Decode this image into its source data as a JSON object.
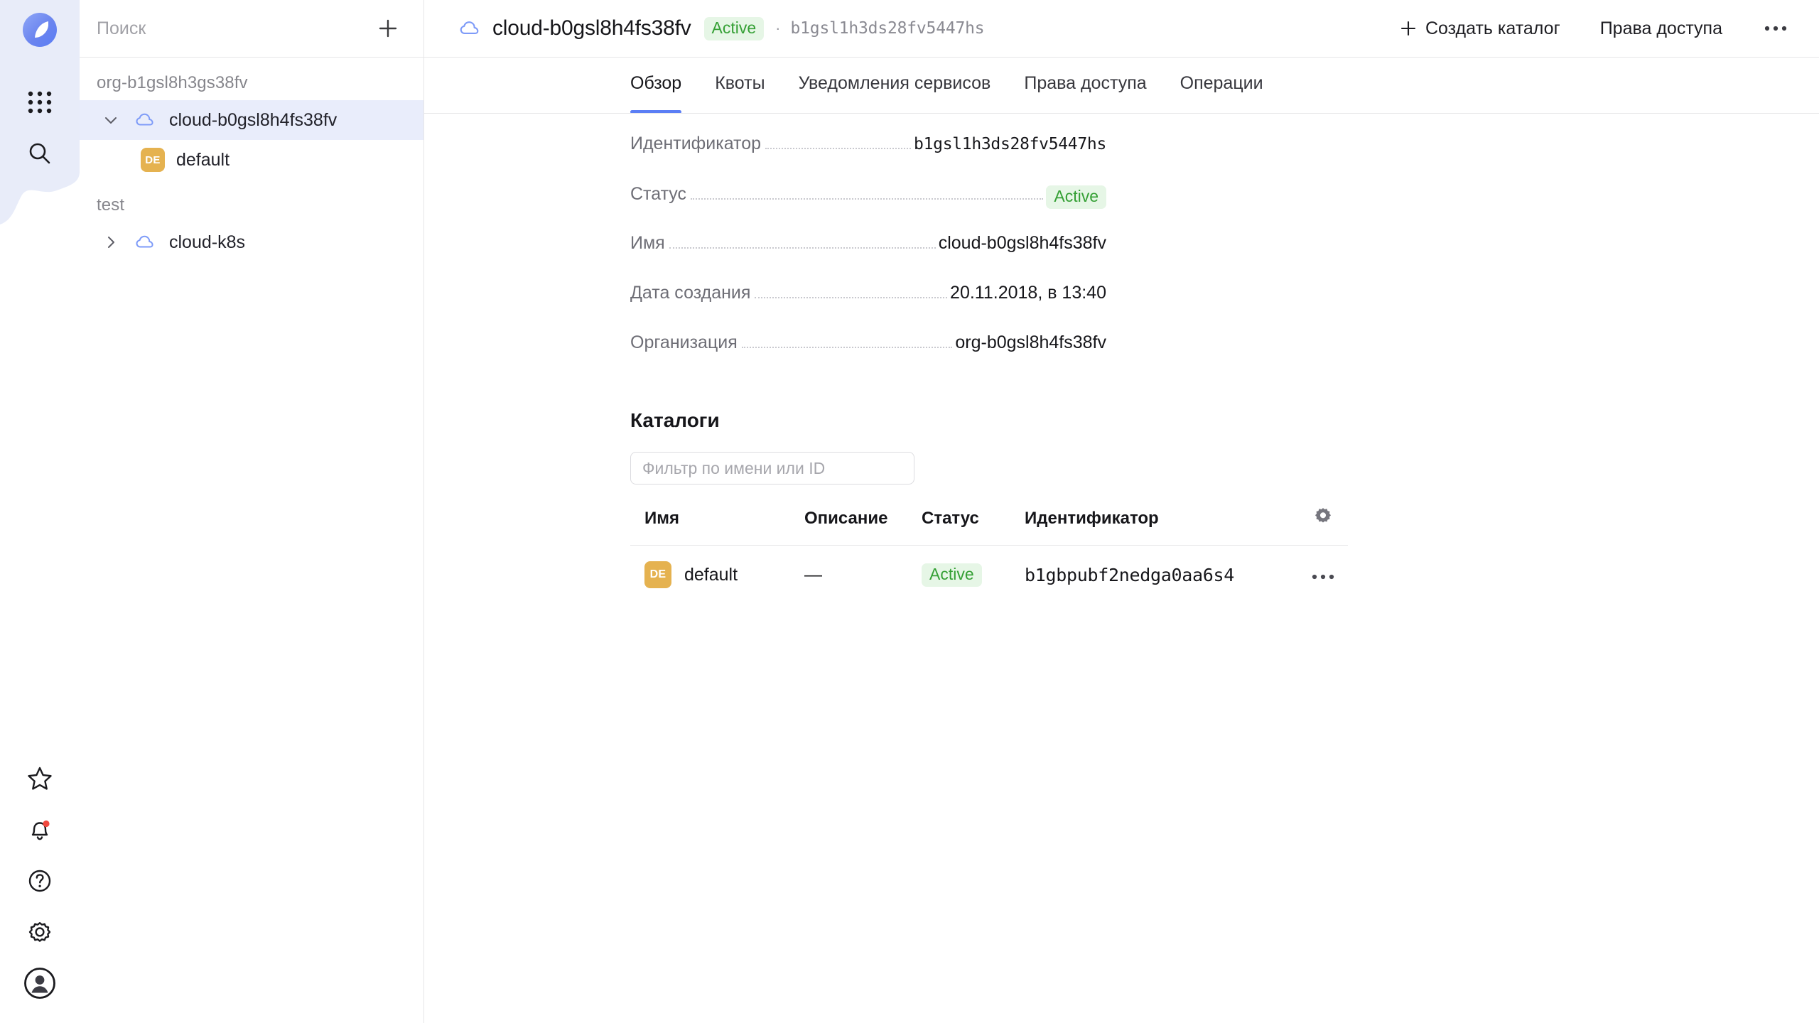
{
  "colors": {
    "accent": "#5b7ef5",
    "selected_row_bg": "#e9edfb",
    "rail_blob_bg": "#e8ecf9",
    "status_green_text": "#35a035",
    "status_green_bg": "#e6f6e6",
    "badge_amber": "#e5b250",
    "notification_dot": "#f0483e"
  },
  "rail": {
    "logo_name": "cloud-console-logo",
    "items": [
      {
        "icon": "grid-apps-icon",
        "name": "apps-grid-button"
      },
      {
        "icon": "search-icon",
        "name": "global-search-button"
      },
      {
        "icon": "star-icon",
        "name": "favorites-button"
      },
      {
        "icon": "bell-icon",
        "name": "notifications-button",
        "has_dot": true
      },
      {
        "icon": "question-circle-icon",
        "name": "help-button"
      },
      {
        "icon": "gear-icon",
        "name": "settings-button"
      },
      {
        "icon": "user-avatar-icon",
        "name": "account-button"
      }
    ]
  },
  "sidebar": {
    "search": {
      "placeholder": "Поиск",
      "value": ""
    },
    "add_button_label": "+",
    "groups": [
      {
        "label": "org-b1gsl8h3gs38fv",
        "rows": [
          {
            "label": "cloud-b0gsl8h4fs38fv",
            "icon": "cloud-icon",
            "selected": true,
            "expanded": true,
            "level": 0
          },
          {
            "label": "default",
            "icon": "folder-badge",
            "badge": "DE",
            "selected": false,
            "level": 1
          }
        ]
      },
      {
        "label": "test",
        "rows": [
          {
            "label": "cloud-k8s",
            "icon": "cloud-icon",
            "selected": false,
            "expanded": false,
            "level": 0
          }
        ]
      }
    ]
  },
  "header": {
    "cloud_icon": "cloud-icon",
    "title": "cloud-b0gsl8h4fs38fv",
    "status": "Active",
    "separator": "·",
    "id": "b1gsl1h3ds28fv5447hs",
    "create_catalog_label": "Создать каталог",
    "access_rights_label": "Права доступа",
    "more_label": "•••"
  },
  "tabs": [
    {
      "label": "Обзор",
      "active": true
    },
    {
      "label": "Квоты",
      "active": false
    },
    {
      "label": "Уведомления сервисов",
      "active": false
    },
    {
      "label": "Права доступа",
      "active": false
    },
    {
      "label": "Операции",
      "active": false
    }
  ],
  "details": [
    {
      "key": "Идентификатор",
      "value": "b1gsl1h3ds28fv5447hs",
      "mono": true
    },
    {
      "key": "Статус",
      "value": "Active",
      "pill": true
    },
    {
      "key": "Имя",
      "value": "cloud-b0gsl8h4fs38fv"
    },
    {
      "key": "Дата создания",
      "value": "20.11.2018, в 13:40"
    },
    {
      "key": "Организация",
      "value": "org-b0gsl8h4fs38fv"
    }
  ],
  "catalogs": {
    "title": "Каталоги",
    "filter": {
      "placeholder": "Фильтр по имени или ID",
      "value": ""
    },
    "columns": [
      "Имя",
      "Описание",
      "Статус",
      "Идентификатор"
    ],
    "settings_icon": "gear-icon",
    "rows": [
      {
        "badge": "DE",
        "name": "default",
        "description": "—",
        "status": "Active",
        "id": "b1gbpubf2nedga0aa6s4",
        "more": "•••"
      }
    ]
  }
}
